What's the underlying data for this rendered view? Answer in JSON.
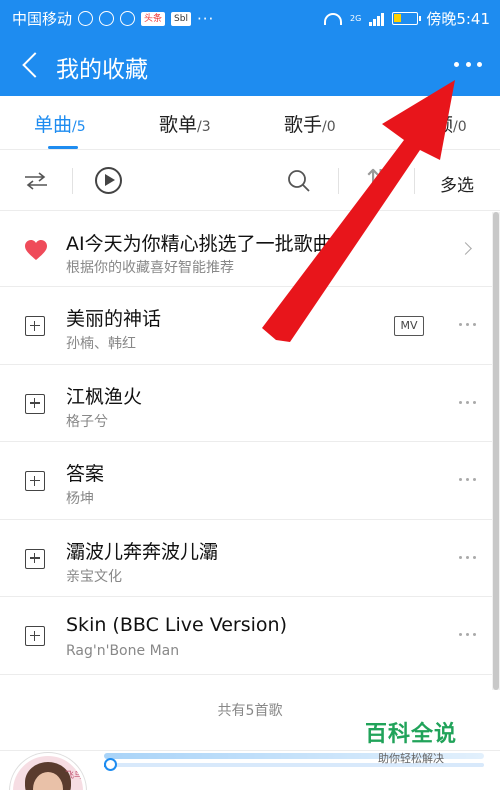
{
  "status_bar": {
    "carrier": "中国移动",
    "network": "2G",
    "time": "傍晚5:41",
    "dots": "···",
    "app_badge": "头条",
    "app_badge2": "Sbl"
  },
  "header": {
    "title": "我的收藏",
    "background_color": "#1e8cf0"
  },
  "tabs": [
    {
      "label": "单曲",
      "count": "/5",
      "active": true
    },
    {
      "label": "歌单",
      "count": "/3",
      "active": false
    },
    {
      "label": "歌手",
      "count": "/0",
      "active": false
    },
    {
      "label": "频",
      "count": "/0",
      "active": false
    }
  ],
  "toolbar": {
    "sort_icon": "⇅",
    "multi_select_label": "多选"
  },
  "ai_recommend": {
    "title": "AI今天为你精心挑选了一批歌曲",
    "subtitle": "根据你的收藏喜好智能推荐"
  },
  "songs": [
    {
      "title": "美丽的神话",
      "artist": "孙楠、韩红",
      "mv": "MV"
    },
    {
      "title": "江枫渔火",
      "artist": "格子兮"
    },
    {
      "title": "答案",
      "artist": "杨坤"
    },
    {
      "title": "灞波儿奔奔波儿灞",
      "artist": "亲宝文化"
    },
    {
      "title": "Skin (BBC Live Version)",
      "artist": "Rag'n'Bone Man"
    }
  ],
  "summary": "共有5首歌",
  "watermark": {
    "main": "百科全说",
    "sub": "助你轻松解决"
  },
  "player": {
    "album_text": "飞鸟",
    "progress": 0.0
  },
  "colors": {
    "accent": "#1e8cf0",
    "heart": "#ef4b5a",
    "arrow": "#e8151b",
    "watermark": "#21a35a"
  }
}
